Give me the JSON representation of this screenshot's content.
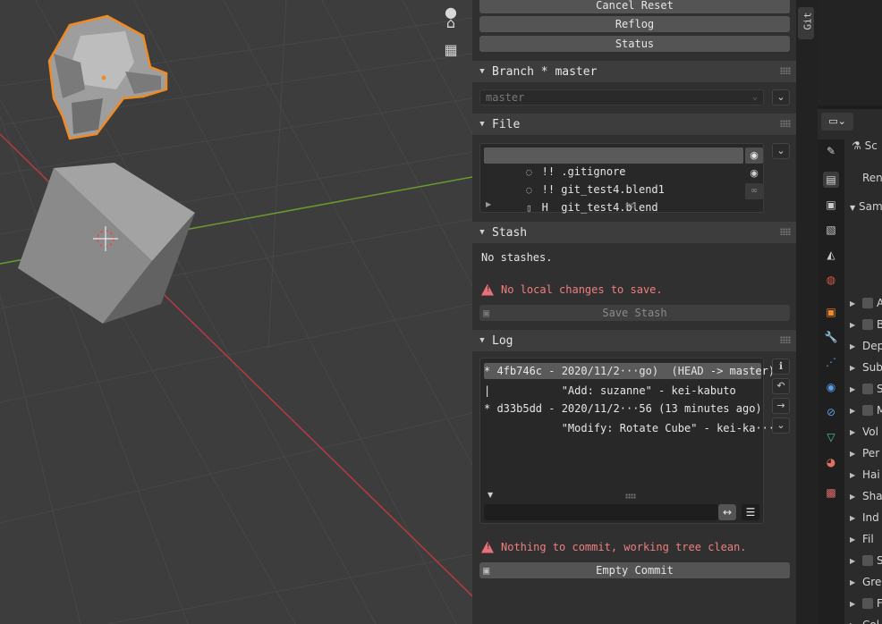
{
  "colors": {
    "selection_orange": "#f08a24",
    "axis_red": "#b63a42",
    "axis_green": "#6a9b2e",
    "warn": "#f07f7f"
  },
  "viewport": {
    "tools": [
      {
        "icon": "sphere-icon"
      },
      {
        "icon": "camera-icon"
      },
      {
        "icon": "grid-icon"
      }
    ]
  },
  "git_panel": {
    "buttons": {
      "cancel_reset": "Cancel Reset",
      "reflog": "Reflog",
      "status": "Status"
    },
    "branch": {
      "header": "Branch * master",
      "dropdown_value": "master"
    },
    "file": {
      "header": "File",
      "rows": [
        {
          "status": "!!",
          "name": ".gitignore"
        },
        {
          "status": "!!",
          "name": "git_test4.blend1"
        },
        {
          "status": "H ",
          "name": "git_test4.blend"
        }
      ]
    },
    "stash": {
      "header": "Stash",
      "empty_text": "No stashes.",
      "warning": "No local changes to save.",
      "save_button": "Save Stash"
    },
    "log": {
      "header": "Log",
      "rows": [
        "* 4fb746c - 2020/11/2···go)  (HEAD -> master)",
        "|           \"Add: suzanne\" - kei-kabuto",
        "* d33b5dd - 2020/11/2···56 (13 minutes ago)",
        "            \"Modify: Rotate Cube\" - kei-ka···"
      ],
      "search_value": ""
    },
    "commit": {
      "warning": "Nothing to commit, working tree clean.",
      "button": "Empty Commit"
    }
  },
  "side_tab": {
    "label": "Git"
  },
  "properties": {
    "title_partial": "Sc",
    "render_label_partial": "Ren",
    "sampling_label_partial": "Sam",
    "rows": [
      {
        "label": "A",
        "checkbox": true
      },
      {
        "label": "B",
        "checkbox": true
      },
      {
        "label": "Dep",
        "checkbox": false
      },
      {
        "label": "Sub",
        "checkbox": false
      },
      {
        "label": "S",
        "checkbox": true
      },
      {
        "label": "M",
        "checkbox": true
      },
      {
        "label": "Vol",
        "checkbox": false
      },
      {
        "label": "Per",
        "checkbox": false
      },
      {
        "label": "Hai",
        "checkbox": false
      },
      {
        "label": "Sha",
        "checkbox": false
      },
      {
        "label": "Ind",
        "checkbox": false
      },
      {
        "label": "Fil",
        "checkbox": false
      },
      {
        "label": "S",
        "checkbox": true
      },
      {
        "label": "Gre",
        "checkbox": false
      },
      {
        "label": "F",
        "checkbox": true
      },
      {
        "label": "Col",
        "checkbox": false
      }
    ]
  }
}
